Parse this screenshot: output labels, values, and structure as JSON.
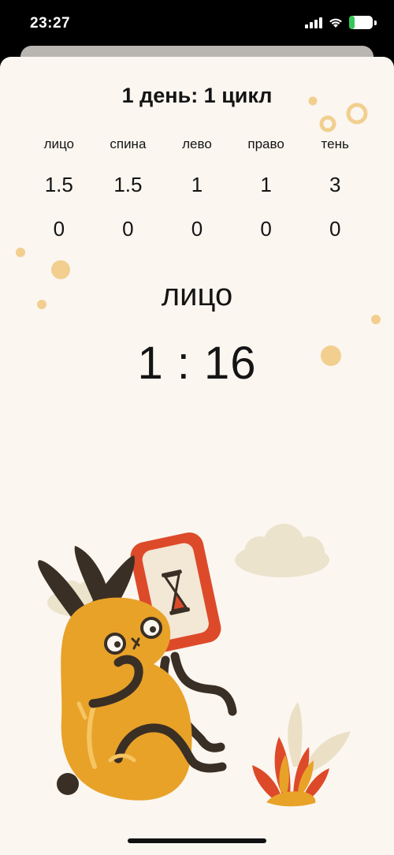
{
  "status_bar": {
    "time": "23:27",
    "battery": "22",
    "battery_level": 0.22,
    "icons": [
      "cellular-signal-icon",
      "wifi-icon",
      "battery-charging-icon"
    ]
  },
  "session": {
    "title": "1 день: 1 цикл",
    "zones": [
      {
        "label": "лицо",
        "duration": "1.5",
        "progress": "0"
      },
      {
        "label": "спина",
        "duration": "1.5",
        "progress": "0"
      },
      {
        "label": "лево",
        "duration": "1",
        "progress": "0"
      },
      {
        "label": "право",
        "duration": "1",
        "progress": "0"
      },
      {
        "label": "тень",
        "duration": "3",
        "progress": "0"
      }
    ],
    "current_zone": "лицо",
    "timer": "1 : 16"
  },
  "illustration": {
    "name": "bunny-holding-phone-with-hourglass",
    "colors": {
      "bunny": "#e8a228",
      "outline": "#3a2f25",
      "phone": "#dd4a2a",
      "cloud": "#ece3cd",
      "dot": "#f2cf8f"
    }
  }
}
